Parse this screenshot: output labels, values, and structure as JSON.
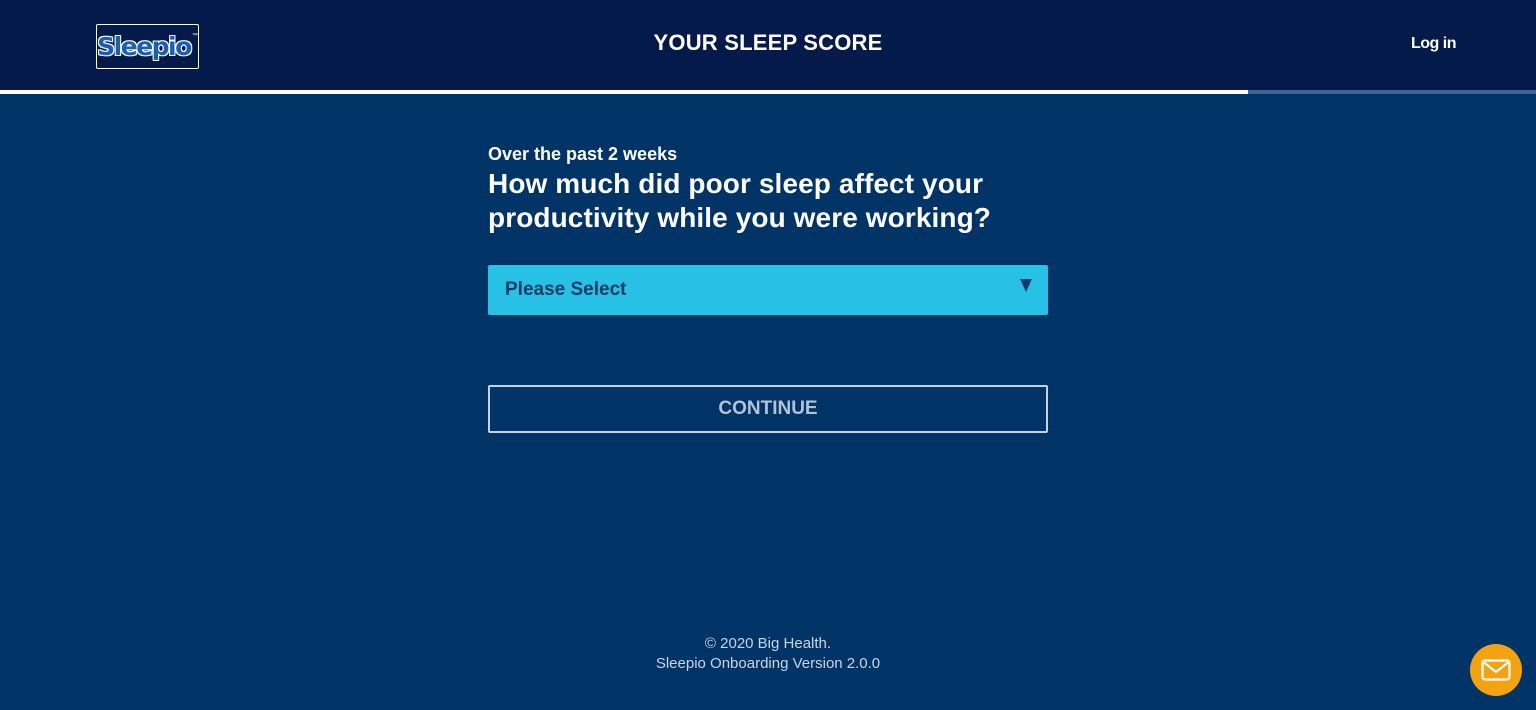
{
  "header": {
    "logo_text": "Sleepio",
    "logo_tm": "™",
    "title": "YOUR SLEEP SCORE",
    "login_label": "Log in"
  },
  "progress": {
    "fraction": 0.8125
  },
  "question": {
    "context": "Over the past 2 weeks",
    "text": "How much did poor sleep affect your productivity while you were working?"
  },
  "select": {
    "selected": "Please Select"
  },
  "actions": {
    "continue_label": "CONTINUE"
  },
  "footer": {
    "copyright": "© 2020 Big Health.",
    "version": "Sleepio Onboarding Version 2.0.0"
  },
  "chat": {
    "icon": "envelope-icon",
    "color": "#f5a20f"
  },
  "colors": {
    "page_background": "#003366",
    "header_background": "#031a4a",
    "select_background": "#26c1e5"
  }
}
